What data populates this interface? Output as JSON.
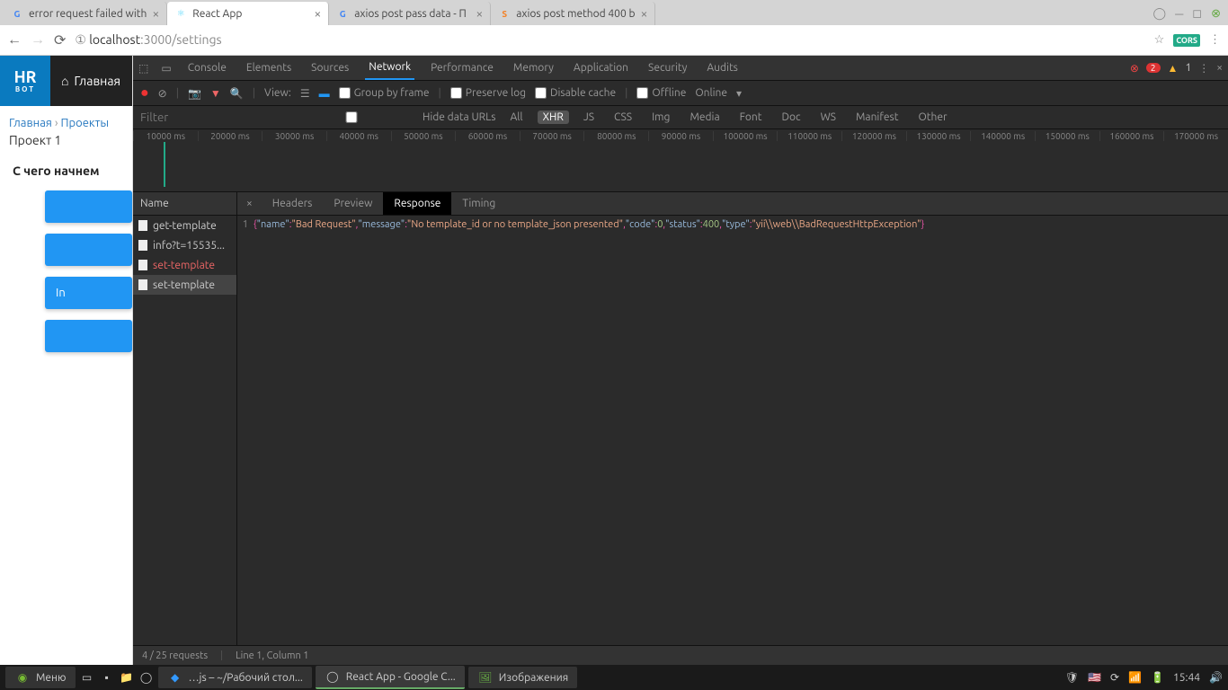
{
  "browser": {
    "tabs": [
      {
        "title": "error request failed with",
        "favicon": "G"
      },
      {
        "title": "React App",
        "favicon": "⚛"
      },
      {
        "title": "axios post pass data - П",
        "favicon": "G"
      },
      {
        "title": "axios post method 400 b",
        "favicon": "S"
      }
    ],
    "url_prefix": "①",
    "url_host": "localhost",
    "url_port": ":3000",
    "url_path": "/settings",
    "cors": "CORS"
  },
  "app": {
    "logo_top": "HR",
    "logo_bottom": "BOT",
    "home": "Главная",
    "breadcrumb": {
      "a": "Главная",
      "sep": "›",
      "b": "Проекты"
    },
    "project": "Проект 1",
    "section": "С чего начнем",
    "btn_in": "In"
  },
  "devtools": {
    "tabs": [
      "Console",
      "Elements",
      "Sources",
      "Network",
      "Performance",
      "Memory",
      "Application",
      "Security",
      "Audits"
    ],
    "active_tab": "Network",
    "errors": "2",
    "warnings": "1",
    "toolbar": {
      "view": "View:",
      "group": "Group by frame",
      "preserve": "Preserve log",
      "disable": "Disable cache",
      "offline": "Offline",
      "online": "Online"
    },
    "filter": {
      "placeholder": "Filter",
      "hide": "Hide data URLs",
      "types": [
        "All",
        "XHR",
        "JS",
        "CSS",
        "Img",
        "Media",
        "Font",
        "Doc",
        "WS",
        "Manifest",
        "Other"
      ],
      "active": "XHR"
    },
    "timeline_ticks": [
      "10000 ms",
      "20000 ms",
      "30000 ms",
      "40000 ms",
      "50000 ms",
      "60000 ms",
      "70000 ms",
      "80000 ms",
      "90000 ms",
      "100000 ms",
      "110000 ms",
      "120000 ms",
      "130000 ms",
      "140000 ms",
      "150000 ms",
      "160000 ms",
      "170000 ms"
    ],
    "requests_header": "Name",
    "requests": [
      {
        "name": "get-template",
        "error": false
      },
      {
        "name": "info?t=15535...",
        "error": false
      },
      {
        "name": "set-template",
        "error": true
      },
      {
        "name": "set-template",
        "error": false,
        "selected": true
      }
    ],
    "detail_tabs": [
      "Headers",
      "Preview",
      "Response",
      "Timing"
    ],
    "detail_active": "Response",
    "response_line": "1",
    "response": {
      "name_k": "\"name\"",
      "name_v": "\"Bad Request\"",
      "msg_k": "\"message\"",
      "msg_v": "\"No template_id or no template_json presented\"",
      "code_k": "\"code\"",
      "code_v": "0",
      "status_k": "\"status\"",
      "status_v": "400",
      "type_k": "\"type\"",
      "type_v": "\"yii\\\\web\\\\BadRequestHttpException\""
    },
    "status_left": "4 / 25 requests",
    "status_right": "Line 1, Column 1"
  },
  "taskbar": {
    "menu": "Меню",
    "items": [
      {
        "label": "…js – ~/Рабочий стол..."
      },
      {
        "label": "React App - Google C..."
      },
      {
        "label": "Изображения"
      }
    ],
    "time": "15:44",
    "flag": "🇺🇸"
  }
}
